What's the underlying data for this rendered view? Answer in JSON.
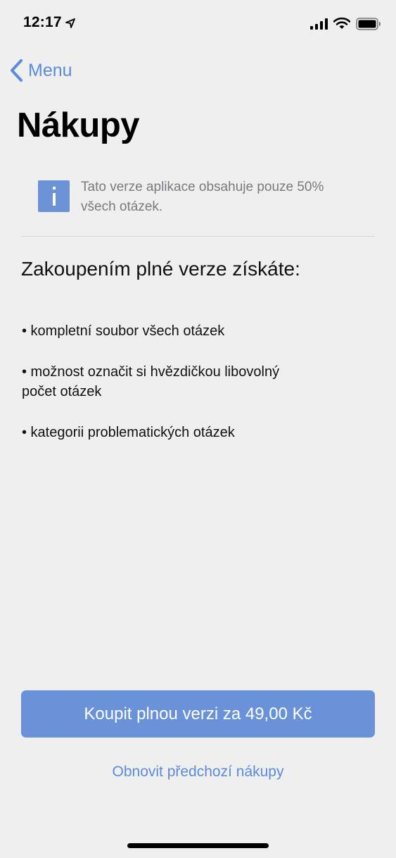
{
  "status_bar": {
    "time": "12:17"
  },
  "nav": {
    "back_label": "Menu"
  },
  "page": {
    "title": "Nákupy"
  },
  "info_banner": {
    "icon": "info-icon",
    "text_line1": "Tato verze aplikace obsahuje pouze 50%",
    "text_line2": "všech otázek."
  },
  "benefits": {
    "heading": "Zakoupením plné verze získáte:",
    "items": [
      {
        "line1": "• kompletní soubor všech otázek"
      },
      {
        "line1": "• možnost označit si hvězdičkou libovolný",
        "line2": "počet otázek"
      },
      {
        "line1": "• kategorii problematických otázek"
      }
    ]
  },
  "actions": {
    "buy_label": "Koupit plnou verzi za 49,00 Kč",
    "restore_label": "Obnovit předchozí nákupy"
  },
  "colors": {
    "accent": "#5b8bd9",
    "button": "#6a92d9",
    "background": "#efeff0"
  }
}
